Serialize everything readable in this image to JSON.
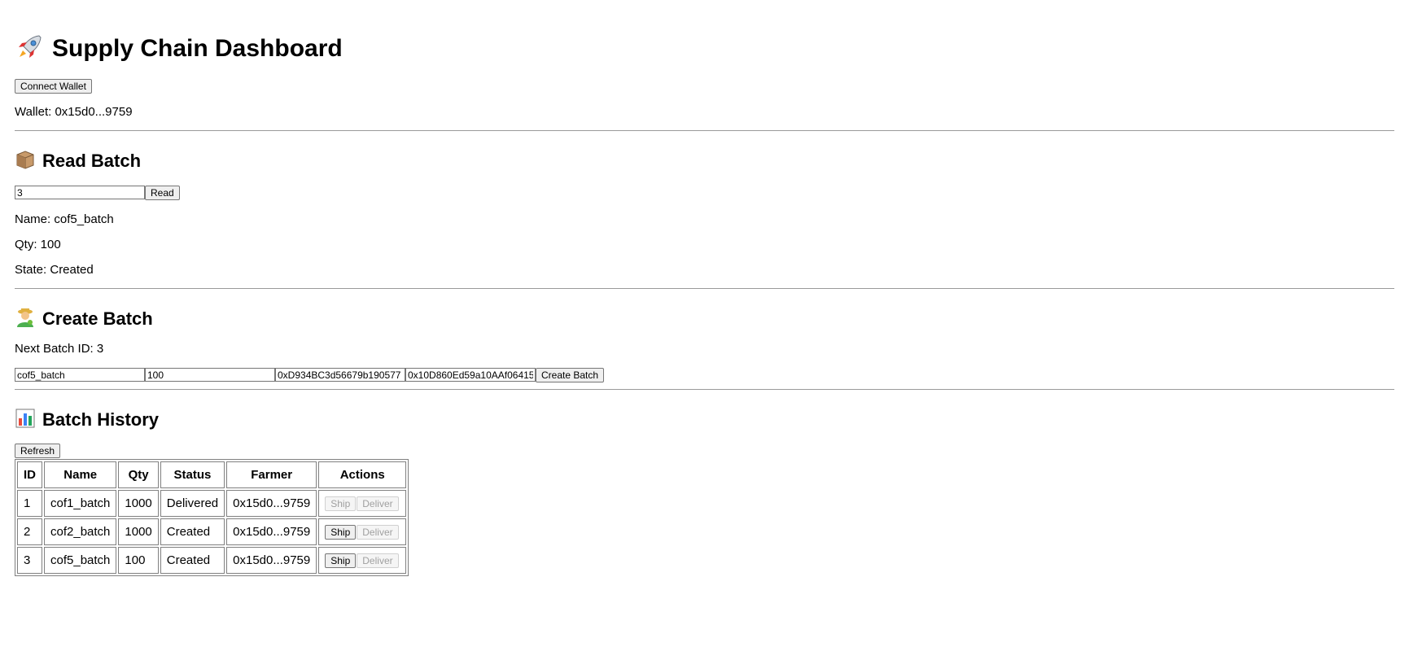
{
  "header": {
    "title": "Supply Chain Dashboard",
    "title_icon": "rocket-icon",
    "connect_label": "Connect Wallet",
    "wallet_text": "Wallet: 0x15d0...9759"
  },
  "read_batch": {
    "heading": "Read Batch",
    "icon": "package-icon",
    "input_value": "3",
    "read_label": "Read",
    "name_text": "Name: cof5_batch",
    "qty_text": "Qty: 100",
    "state_text": "State: Created"
  },
  "create_batch": {
    "heading": "Create Batch",
    "icon": "farmer-icon",
    "next_id_text": "Next Batch ID: 3",
    "name_value": "cof5_batch",
    "qty_value": "100",
    "addr1_value": "0xD934BC3d56679b190577",
    "addr2_value": "0x10D860Ed59a10AAf06415",
    "create_label": "Create Batch"
  },
  "history": {
    "heading": "Batch History",
    "icon": "bar-chart-icon",
    "refresh_label": "Refresh",
    "columns": [
      "ID",
      "Name",
      "Qty",
      "Status",
      "Farmer",
      "Actions"
    ],
    "ship_label": "Ship",
    "deliver_label": "Deliver",
    "rows": [
      {
        "id": "1",
        "name": "cof1_batch",
        "qty": "1000",
        "status": "Delivered",
        "farmer": "0x15d0...9759",
        "ship_enabled": false,
        "deliver_enabled": false
      },
      {
        "id": "2",
        "name": "cof2_batch",
        "qty": "1000",
        "status": "Created",
        "farmer": "0x15d0...9759",
        "ship_enabled": true,
        "deliver_enabled": false
      },
      {
        "id": "3",
        "name": "cof5_batch",
        "qty": "100",
        "status": "Created",
        "farmer": "0x15d0...9759",
        "ship_enabled": true,
        "deliver_enabled": false
      }
    ]
  }
}
